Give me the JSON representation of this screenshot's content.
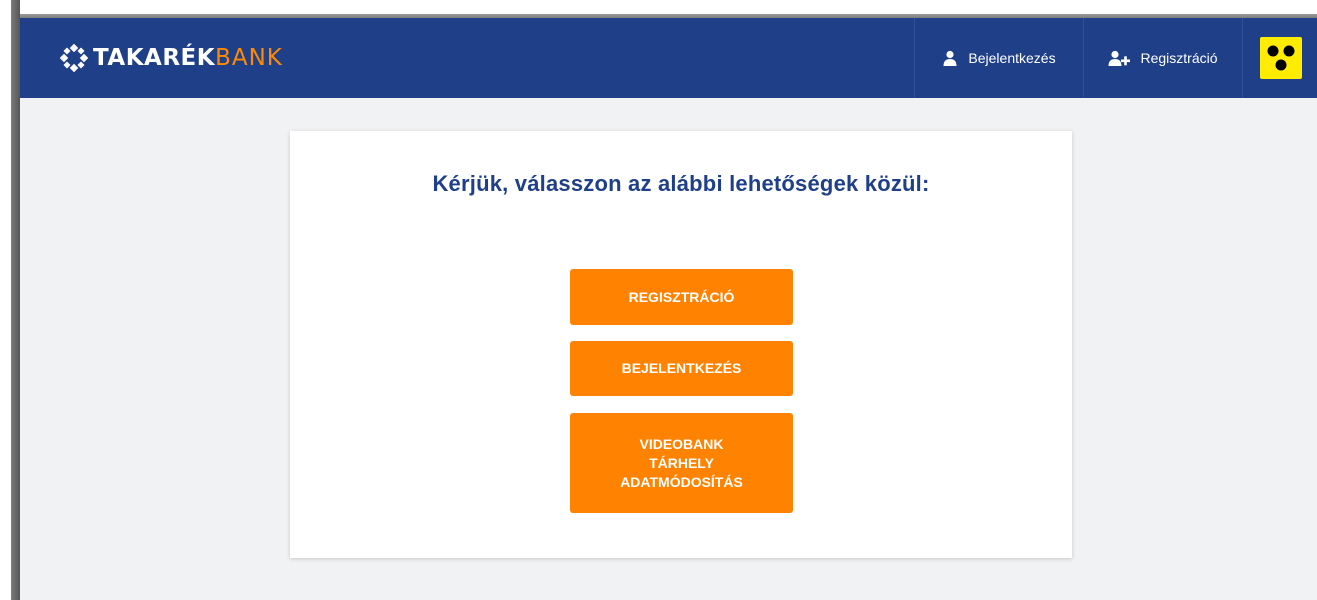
{
  "header": {
    "logo": {
      "text_main": "TAKARÉK",
      "text_accent": "BANK"
    },
    "nav": {
      "login_label": "Bejelentkezés",
      "register_label": "Regisztráció",
      "accessibility_label": ""
    }
  },
  "main": {
    "title": "Kérjük, válasszon az alábbi lehetőségek közül:",
    "buttons": {
      "register": "REGISZTRÁCIÓ",
      "login": "BEJELENTKEZÉS",
      "videobank": "VIDEOBANK\nTÁRHELY\nADATMÓDOSÍTÁS"
    }
  },
  "colors": {
    "navbar": "#1f3f89",
    "accent_orange": "#ff8200",
    "page_background": "#f1f2f4",
    "accessibility_badge": "#ffec00"
  },
  "icons": {
    "logo": "takarek-flower-logo-icon",
    "login": "user-icon",
    "register": "user-plus-icon",
    "accessibility": "braille-dots-icon"
  }
}
